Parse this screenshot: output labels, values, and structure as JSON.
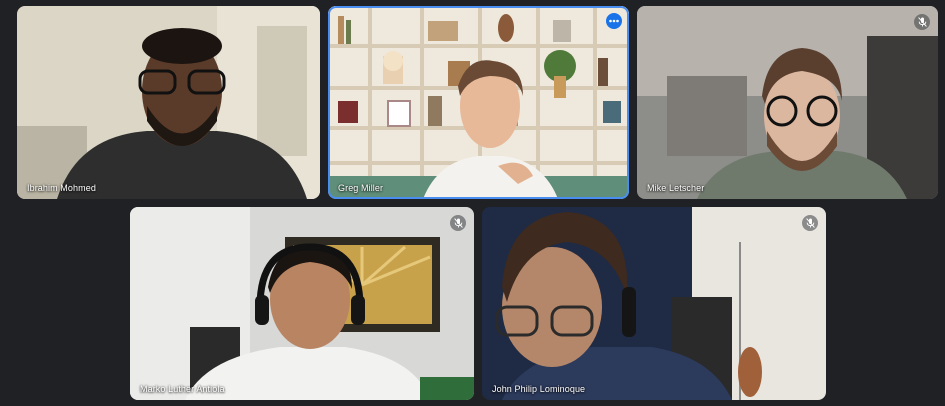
{
  "meeting": {
    "participants": [
      {
        "name": "Ibrahim Mohmed",
        "muted": false
      },
      {
        "name": "Greg Miller",
        "muted": false,
        "speaking": true
      },
      {
        "name": "Mike Letscher",
        "muted": true
      },
      {
        "name": "Marko Luther Antiola",
        "muted": true
      },
      {
        "name": "John Philip Lominoque",
        "muted": true
      }
    ]
  },
  "icons": {
    "mute": "mic-off-icon",
    "more": "more-options-icon"
  },
  "colors": {
    "background": "#202124",
    "active_border": "#4a8df0",
    "more_button": "#1a73e8"
  }
}
